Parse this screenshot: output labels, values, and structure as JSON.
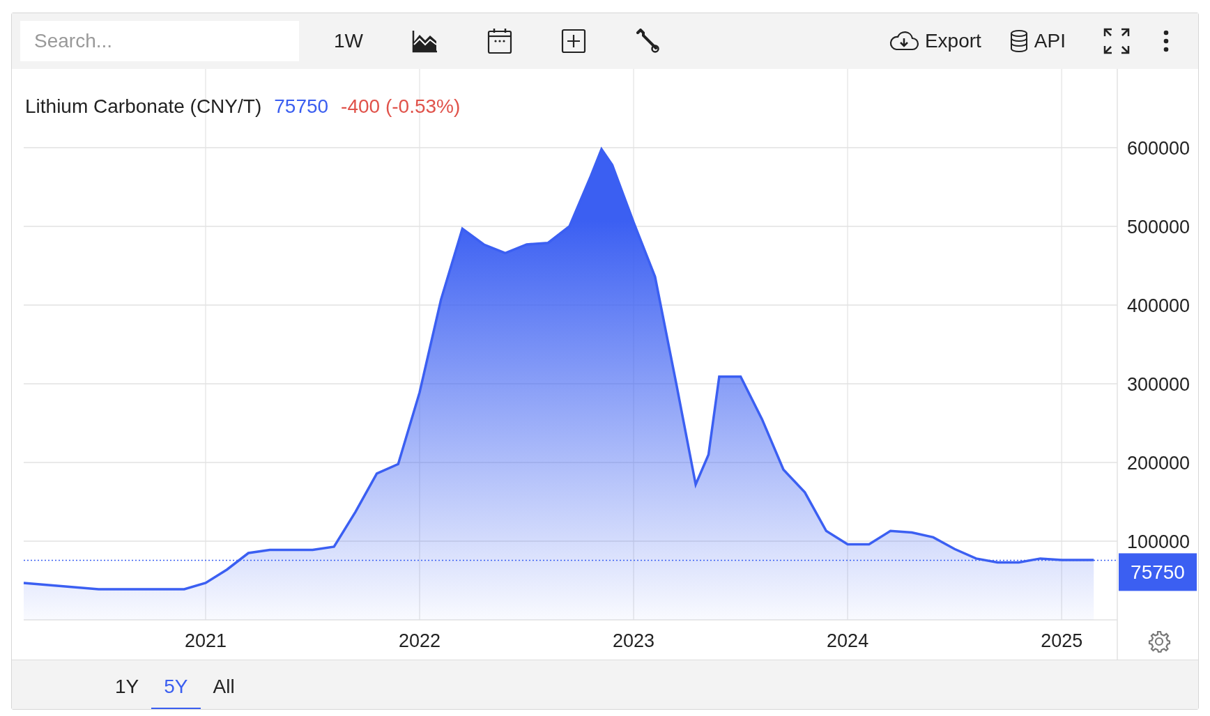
{
  "toolbar": {
    "search": {
      "placeholder": "Search..."
    },
    "interval": "1W",
    "export": "Export",
    "api": "API"
  },
  "chart": {
    "price": "75750",
    "change": "-400 (-0.53%)",
    "chart_data": {
      "type": "area",
      "title": "Lithium Carbonate (CNY/T)",
      "x": [
        2020.15,
        2020.5,
        2020.9,
        2021.0,
        2021.1,
        2021.2,
        2021.3,
        2021.5,
        2021.6,
        2021.7,
        2021.8,
        2021.9,
        2022.0,
        2022.1,
        2022.2,
        2022.3,
        2022.4,
        2022.5,
        2022.6,
        2022.7,
        2022.8,
        2022.85,
        2022.9,
        2023.0,
        2023.1,
        2023.2,
        2023.29,
        2023.35,
        2023.4,
        2023.5,
        2023.6,
        2023.7,
        2023.8,
        2023.9,
        2024.0,
        2024.1,
        2024.2,
        2024.3,
        2024.4,
        2024.5,
        2024.6,
        2024.7,
        2024.8,
        2024.9,
        2025.0,
        2025.15
      ],
      "series": [
        {
          "color": "#3b5ff2",
          "values": [
            47000,
            39000,
            39000,
            47000,
            64000,
            85000,
            89000,
            89000,
            93000,
            137000,
            186000,
            198000,
            289000,
            407000,
            497000,
            477000,
            466000,
            477000,
            479000,
            500000,
            564000,
            598000,
            578000,
            505000,
            436000,
            299000,
            172000,
            210000,
            309000,
            309000,
            255000,
            191000,
            162000,
            113000,
            96000,
            96000,
            113000,
            111000,
            105000,
            90000,
            78000,
            73000,
            73000,
            78000,
            76000,
            76000
          ]
        }
      ],
      "ref_lines": [
        {
          "axis": "y",
          "value": 75750,
          "color": "#3b5ff2",
          "label": "75750"
        }
      ],
      "grid": true,
      "xlim": [
        2020.15,
        2025.26
      ],
      "ylim": [
        0,
        700000
      ],
      "xticks": [
        2021,
        2022,
        2023,
        2024,
        2025
      ],
      "yticks": [
        100000,
        200000,
        300000,
        400000,
        500000,
        600000
      ]
    }
  },
  "range_tabs": [
    {
      "label": "1Y",
      "selected": false
    },
    {
      "label": "5Y",
      "selected": true
    },
    {
      "label": "All",
      "selected": false
    }
  ]
}
